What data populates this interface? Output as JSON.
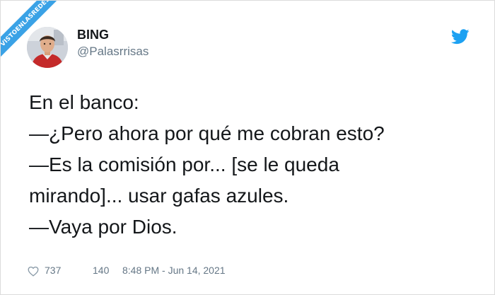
{
  "watermark": {
    "text": "VISTOENLASREDES"
  },
  "tweet": {
    "author_name": "BING",
    "author_handle": "@Palasrrisas",
    "text_lines": [
      "En el banco:",
      "—¿Pero ahora por qué me cobran esto?",
      "—Es la comisión por... [se le queda",
      "mirando]... usar gafas azules.",
      "—Vaya por Dios."
    ],
    "likes": "737",
    "retweets": "140",
    "timestamp": "8:48 PM - Jun 14, 2021",
    "icons": {
      "platform": "twitter-bird-icon",
      "like": "heart-icon"
    },
    "colors": {
      "brand": "#1da1f2",
      "watermark": "#3aa2e6",
      "text": "#14171a",
      "secondary": "#657786"
    }
  }
}
